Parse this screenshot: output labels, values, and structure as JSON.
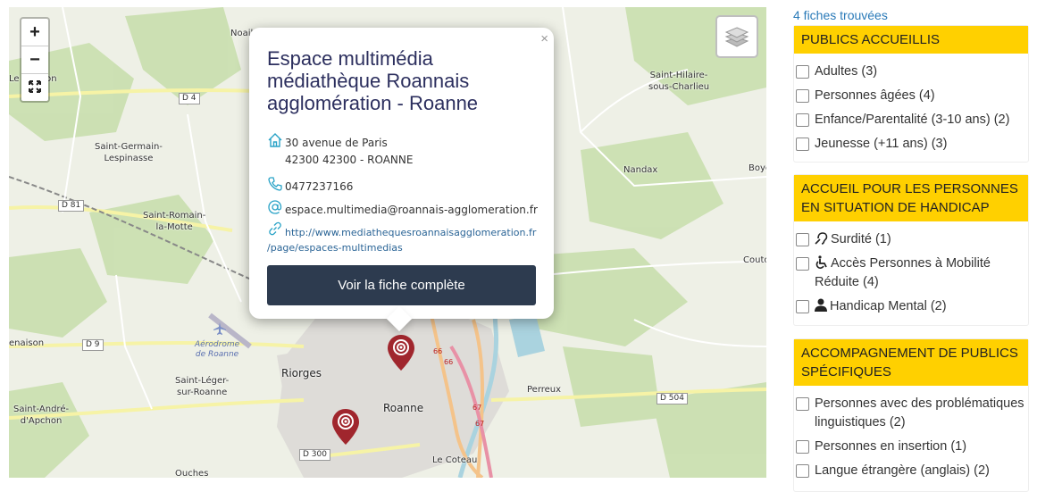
{
  "map": {
    "zoom_in": "+",
    "zoom_out": "−",
    "fullscreen_icon": "fullscreen-icon",
    "layers_icon": "layers-icon",
    "places": {
      "noailly": "Noail",
      "lebuisson": "Le Buisson",
      "saintgermain": "Saint-Germain-\nLespinasse",
      "saintromain": "Saint-Romain-\nla-Motte",
      "saintlegersr": "Saint-Léger-\nsur-Roanne",
      "saintandre": "Saint-André-\nd'Apchon",
      "riorges": "Riorges",
      "roanne": "Roanne",
      "lecoteau": "Le Coteau",
      "ouches": "Ouches",
      "perreux": "Perreux",
      "nandax": "Nandax",
      "saintHilaire": "Saint-Hilaire-\nsous-Charlieu",
      "boye": "Boye",
      "couto": "Couto",
      "renaison": "enaison"
    },
    "airport": "Aérodrome\nde Roanne",
    "roads": {
      "d4": "D 4",
      "d81": "D 81",
      "d9": "D 9",
      "d300": "D 300",
      "d504": "D 504",
      "r66a": "66",
      "r66b": "66",
      "r67a": "67",
      "r67b": "67"
    }
  },
  "popup": {
    "title": "Espace multimédia médiathèque Roannais agglomération - Roanne",
    "close": "×",
    "address_line1": "30 avenue de Paris",
    "address_line2": "42300 42300 - ROANNE",
    "phone": "0477237166",
    "email": "espace.multimedia@roannais-agglomeration.fr",
    "website_line1": "http://www.mediathequesroannaisagglomeration.fr",
    "website_line2": "/page/espaces-multimedias",
    "button": "Voir la fiche complète"
  },
  "sidebar": {
    "count": "4 fiches trouvées",
    "panels": [
      {
        "title": "PUBLICS ACCUEILLIS",
        "options": [
          "Adultes (3)",
          "Personnes âgées (4)",
          "Enfance/Parentalité (3-10 ans) (2)",
          "Jeunesse (+11 ans) (3)"
        ]
      },
      {
        "title": "ACCUEIL POUR LES PERSONNES EN SITUATION DE HANDICAP",
        "options": [
          "Surdité (1)",
          "Accès Personnes à Mobilité Réduite (4)",
          "Handicap Mental (2)"
        ]
      },
      {
        "title": "ACCOMPAGNEMENT DE PUBLICS SPÉCIFIQUES",
        "options": [
          "Personnes avec des problématiques linguistiques (2)",
          "Personnes en insertion (1)",
          "Langue étrangère (anglais) (2)"
        ]
      }
    ]
  },
  "colors": {
    "accent": "#ffd000",
    "button": "#2d3b4f",
    "marker": "#a0262d",
    "link": "#2a7ab8"
  }
}
